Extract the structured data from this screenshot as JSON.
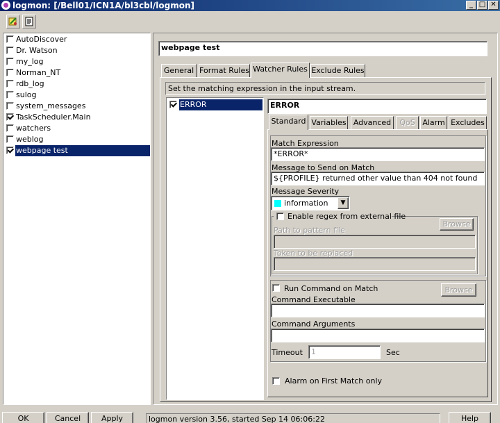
{
  "window": {
    "title": "logmon: [/Bell01/ICN1A/bl3cbl/logmon]",
    "minimize": "_",
    "maximize": "□",
    "close": "✕"
  },
  "toolbar": {
    "icons": [
      "tools-icon",
      "document-icon"
    ]
  },
  "tree": {
    "items": [
      {
        "label": "AutoDiscover",
        "checked": false
      },
      {
        "label": "Dr. Watson",
        "checked": false
      },
      {
        "label": "my_log",
        "checked": false
      },
      {
        "label": "Norman_NT",
        "checked": false
      },
      {
        "label": "rdb_log",
        "checked": false
      },
      {
        "label": "sulog",
        "checked": false
      },
      {
        "label": "system_messages",
        "checked": false
      },
      {
        "label": "TaskScheduler.Main",
        "checked": true
      },
      {
        "label": "watchers",
        "checked": false
      },
      {
        "label": "weblog",
        "checked": false
      },
      {
        "label": "webpage test",
        "checked": true,
        "selected": true
      }
    ]
  },
  "profile": {
    "name": "webpage test"
  },
  "main_tabs": [
    {
      "label": "General"
    },
    {
      "label": "Format Rules"
    },
    {
      "label": "Watcher Rules",
      "active": true
    },
    {
      "label": "Exclude Rules"
    }
  ],
  "watcher": {
    "hint": "Set the matching expression in the input stream.",
    "watchers_list": [
      {
        "label": "ERROR",
        "checked": true,
        "selected": true
      }
    ],
    "selected_name": "ERROR",
    "sub_tabs": [
      {
        "label": "Standard",
        "active": true
      },
      {
        "label": "Variables"
      },
      {
        "label": "Advanced"
      },
      {
        "label": "QoS",
        "disabled": true
      },
      {
        "label": "Alarm"
      },
      {
        "label": "Excludes"
      }
    ],
    "match_expression_label": "Match Expression",
    "match_expression_value": "*ERROR*",
    "message_label": "Message to Send on Match",
    "message_value": "${PROFILE} returned other value than 404 not found",
    "severity_label": "Message Severity",
    "severity_value": "information",
    "severity_color": "#00ffff",
    "regex_checkbox_label": "Enable regex from external file",
    "regex_checked": false,
    "regex_browse_label": "Browse",
    "path_label": "Path to pattern file",
    "path_value": "",
    "token_label": "Token to be replaced",
    "token_value": "",
    "run_command_label": "Run Command on Match",
    "run_command_checked": false,
    "command_browse_label": "Browse",
    "command_exec_label": "Command Executable",
    "command_exec_value": "",
    "command_args_label": "Command Arguments",
    "command_args_value": "",
    "timeout_label": "Timeout",
    "timeout_value": "1",
    "timeout_unit": "Sec",
    "alarm_first_label": "Alarm on First Match only",
    "alarm_first_checked": false
  },
  "footer": {
    "ok_label": "OK",
    "cancel_label": "Cancel",
    "apply_label": "Apply",
    "status_text": "logmon version 3.56, started Sep 14 06:06:22",
    "help_label": "Help"
  }
}
